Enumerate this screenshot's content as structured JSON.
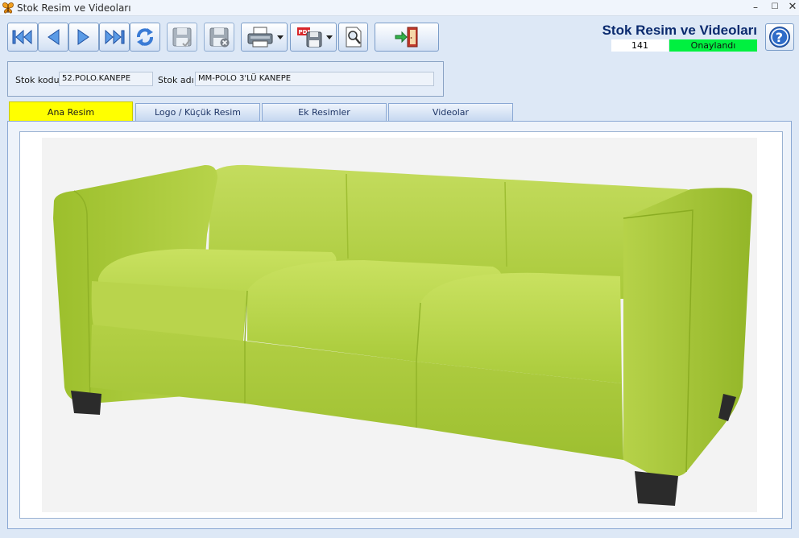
{
  "window": {
    "title": "Stok Resim ve Videoları",
    "minimize": "–",
    "maximize": "☐",
    "close": "✕"
  },
  "header": {
    "title": "Stok Resim ve Videoları",
    "count": "141",
    "status": "Onaylandı",
    "status_color": "#00f040"
  },
  "toolbar": {
    "buttons": [
      "first-record",
      "previous-record",
      "next-record",
      "last-record",
      "refresh",
      "save",
      "delete",
      "print",
      "export-pdf",
      "search",
      "exit"
    ]
  },
  "form": {
    "stok_kodu_label": "Stok kodu",
    "stok_kodu_value": "52.POLO.KANEPE",
    "stok_adi_label": "Stok adı",
    "stok_adi_value": "MM-POLO 3'LÜ KANEPE"
  },
  "tabs": [
    {
      "label": "Ana Resim",
      "active": true
    },
    {
      "label": "Logo / Küçük Resim",
      "active": false
    },
    {
      "label": "Ek Resimler",
      "active": false
    },
    {
      "label": "Videolar",
      "active": false
    }
  ],
  "image": {
    "subject": "lime green three-seat sofa",
    "color": "#a8cc3a"
  },
  "colors": {
    "active_tab": "#ffff00",
    "title_text": "#0a2a6e"
  }
}
